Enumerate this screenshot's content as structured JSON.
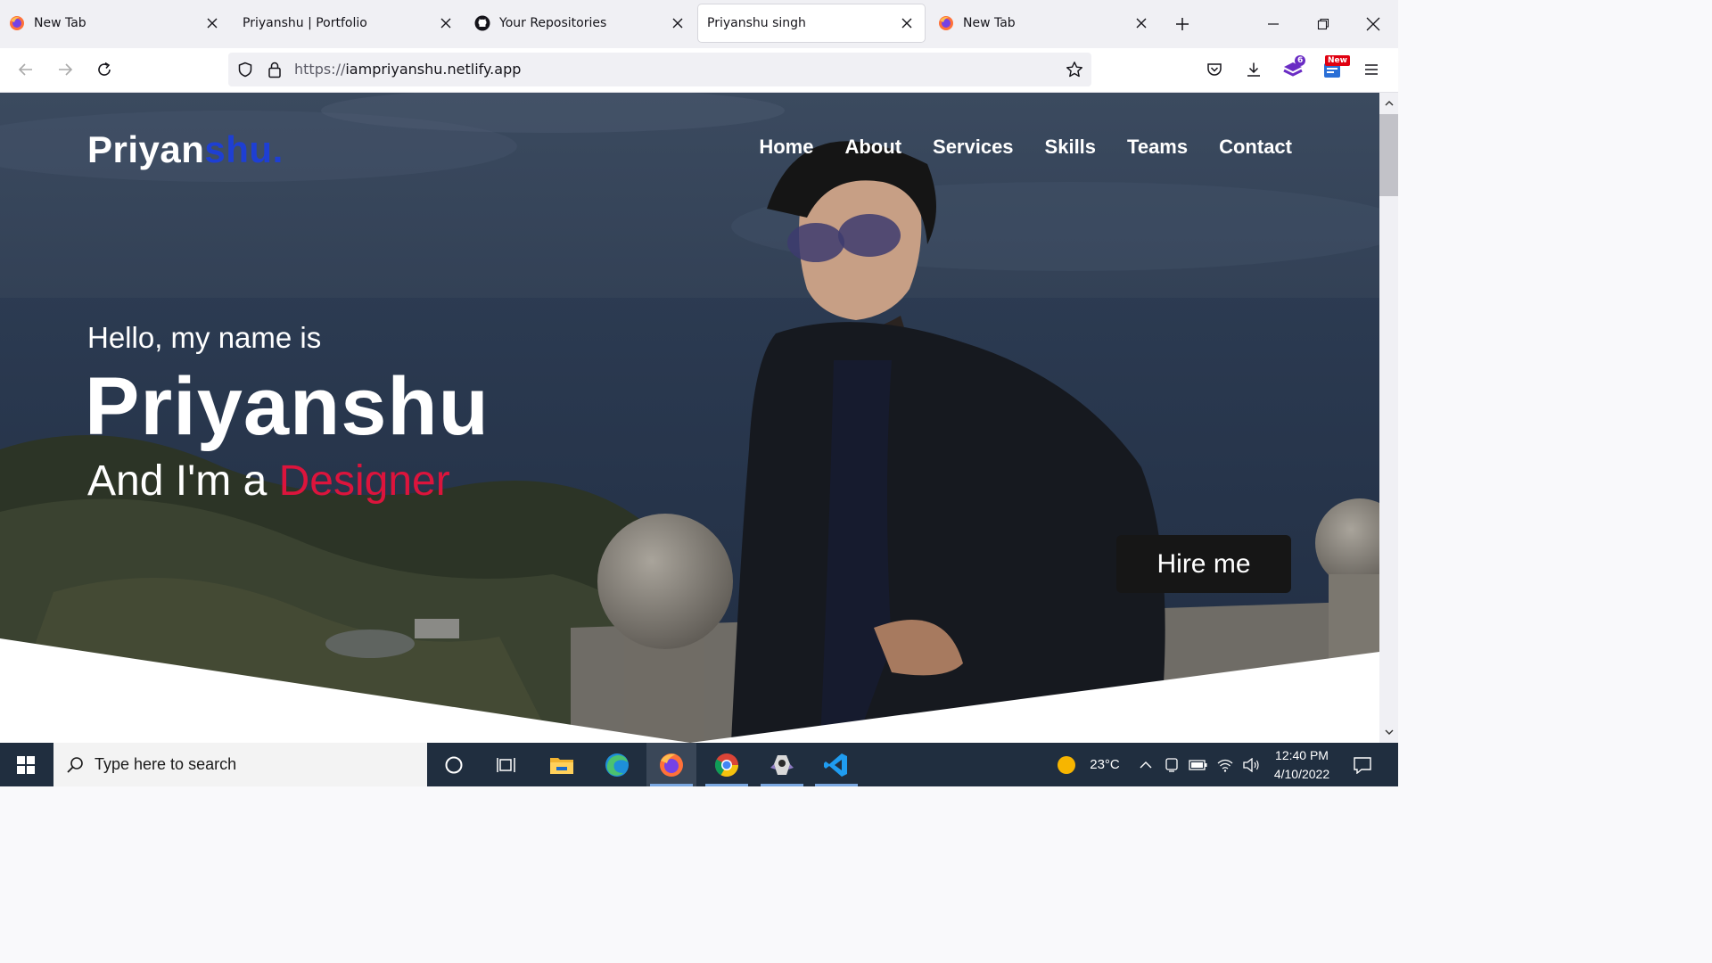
{
  "browser": {
    "tabs": [
      {
        "title": "New Tab",
        "favicon": "firefox-icon",
        "active": false
      },
      {
        "title": "Priyanshu | Portfolio",
        "favicon": "none",
        "active": false
      },
      {
        "title": "Your Repositories",
        "favicon": "github-icon",
        "active": false
      },
      {
        "title": "Priyanshu singh",
        "favicon": "none",
        "active": true
      },
      {
        "title": "New Tab",
        "favicon": "firefox-icon",
        "active": false
      }
    ],
    "url_scheme": "https://",
    "url_host": "iampriyanshu.netlify.app",
    "extensions": [
      {
        "name": "pocket-icon"
      },
      {
        "name": "download-icon"
      },
      {
        "name": "extension-stack-icon",
        "badge": "6"
      },
      {
        "name": "news-extension-icon",
        "badge": "New"
      }
    ]
  },
  "page": {
    "brand_prefix": "Priyan",
    "brand_accent": "shu.",
    "nav": [
      "Home",
      "About",
      "Services",
      "Skills",
      "Teams",
      "Contact"
    ],
    "greeting": "Hello, my name is",
    "name": "Priyanshu",
    "role_prefix": "And I'm a ",
    "role_highlight": "Designer",
    "cta": "Hire me",
    "colors": {
      "brand_accent": "#1e3fd3",
      "role_highlight": "#dc143c",
      "cta_bg": "#161616"
    }
  },
  "taskbar": {
    "search_placeholder": "Type here to search",
    "apps": [
      "cortana-icon",
      "task-view-icon",
      "file-explorer-icon",
      "edge-icon",
      "firefox-icon",
      "chrome-icon",
      "game-app-icon",
      "vscode-icon"
    ],
    "weather_temp": "23°C",
    "time": "12:40 PM",
    "date": "4/10/2022"
  }
}
